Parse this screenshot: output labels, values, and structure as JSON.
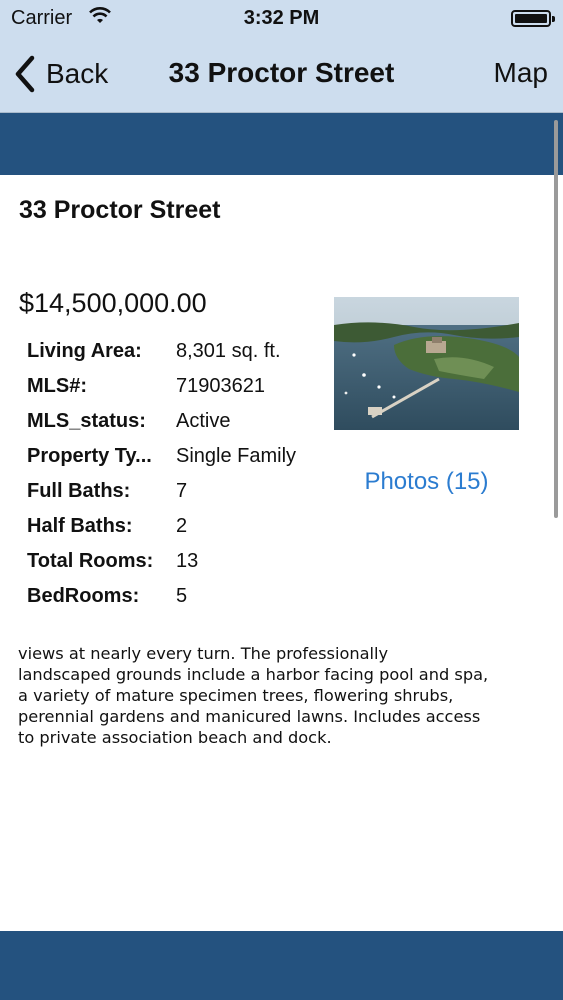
{
  "status_bar": {
    "carrier": "Carrier",
    "time": "3:32 PM"
  },
  "nav": {
    "back_label": "Back",
    "title": "33 Proctor Street",
    "map_label": "Map"
  },
  "listing": {
    "title": "33 Proctor Street",
    "price": "$14,500,000.00",
    "details": [
      {
        "label": "Living Area:",
        "value": "8,301 sq. ft."
      },
      {
        "label": "MLS#:",
        "value": "71903621"
      },
      {
        "label": "MLS_status:",
        "value": "Active"
      },
      {
        "label": "Property Ty...",
        "value": "Single Family"
      },
      {
        "label": "Full Baths:",
        "value": "7"
      },
      {
        "label": "Half Baths:",
        "value": "2"
      },
      {
        "label": "Total Rooms:",
        "value": "13"
      },
      {
        "label": "BedRooms:",
        "value": "5"
      }
    ],
    "photos_link": "Photos (15)",
    "description": " views at nearly every turn.  The professionally\nlandscaped grounds include a harbor facing pool and spa,\na variety of mature specimen trees, flowering shrubs,\nperennial gardens and manicured lawns.  Includes access\nto private association beach and dock."
  },
  "colors": {
    "nav_bg": "#cdddee",
    "band": "#24527f",
    "link": "#2b7cd0"
  }
}
